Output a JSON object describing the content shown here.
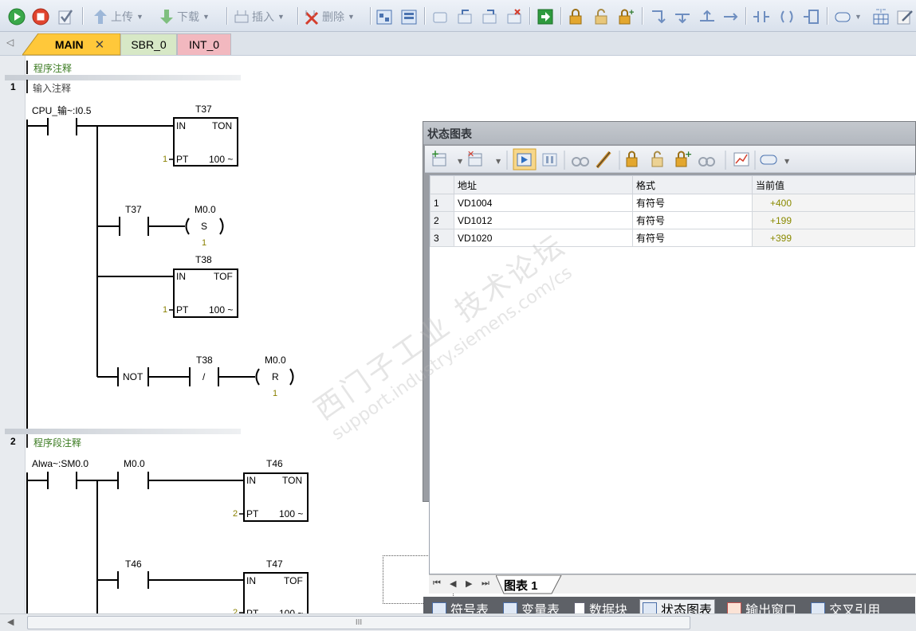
{
  "toolbar": {
    "upload_label": "上传",
    "download_label": "下载",
    "insert_label": "插入",
    "delete_label": "删除"
  },
  "tabs": [
    {
      "label": "MAIN"
    },
    {
      "label": "SBR_0"
    },
    {
      "label": "INT_0"
    }
  ],
  "tab_close_glyph": "✕",
  "program_comment": "程序注释",
  "network1": {
    "number": "1",
    "comment": "输入注释",
    "contact_input": "CPU_输~:I0.5",
    "t37_title": "T37",
    "t37_in": "IN",
    "t37_type": "TON",
    "t37_pt_val": "1",
    "t37_pt": "PT",
    "t37_ms": "100 ~",
    "t37_contact": "T37",
    "m00_set_addr": "M0.0",
    "set_coil": "S",
    "set_val": "1",
    "t38_title": "T38",
    "t38_in": "IN",
    "t38_type": "TOF",
    "t38_pt_val": "1",
    "t38_pt": "PT",
    "t38_ms": "100 ~",
    "not_label": "NOT",
    "t38_contact": "T38",
    "t38_slash": "/",
    "m00_reset_addr": "M0.0",
    "reset_coil": "R",
    "reset_val": "1"
  },
  "network2": {
    "number": "2",
    "comment": "程序段注释",
    "contact_input": "Alwa~:SM0.0",
    "contact_m00": "M0.0",
    "t46_title": "T46",
    "t46_in": "IN",
    "t46_type": "TON",
    "t46_pt_val": "2",
    "t46_pt": "PT",
    "t46_ms": "100 ~",
    "t46_contact": "T46",
    "t47_title": "T47",
    "t47_in": "IN",
    "t47_type": "TOF",
    "t47_pt_val": "2",
    "t47_pt": "PT",
    "t47_ms": "100 ~"
  },
  "status_chart": {
    "title": "状态图表",
    "columns": [
      "地址",
      "格式",
      "当前值"
    ],
    "rows": [
      {
        "n": "1",
        "addr": "VD1004",
        "fmt": "有符号",
        "value": "+400"
      },
      {
        "n": "2",
        "addr": "VD1012",
        "fmt": "有符号",
        "value": "+199"
      },
      {
        "n": "3",
        "addr": "VD1020",
        "fmt": "有符号",
        "value": "+399"
      }
    ],
    "sheet_tab": "图表 1",
    "nav_glyphs": [
      "⏮",
      "◀",
      "▶",
      "⏭"
    ]
  },
  "bottom_tabs": [
    {
      "label": "符号表"
    },
    {
      "label": "变量表"
    },
    {
      "label": "数据块"
    },
    {
      "label": "状态图表"
    },
    {
      "label": "输出窗口"
    },
    {
      "label": "交叉引用"
    }
  ],
  "scroll_thumb_glyph": "III",
  "watermark": {
    "line1": "西门子工业  技术论坛",
    "line2": "support.industry.siemens.com/cs"
  },
  "colors": {
    "accent_tab": "#ffc83a",
    "sbr_tab": "#d7e8c6",
    "int_tab": "#f2b8bf",
    "value_color": "#8a8a00",
    "comment_color": "#3a7a20"
  }
}
